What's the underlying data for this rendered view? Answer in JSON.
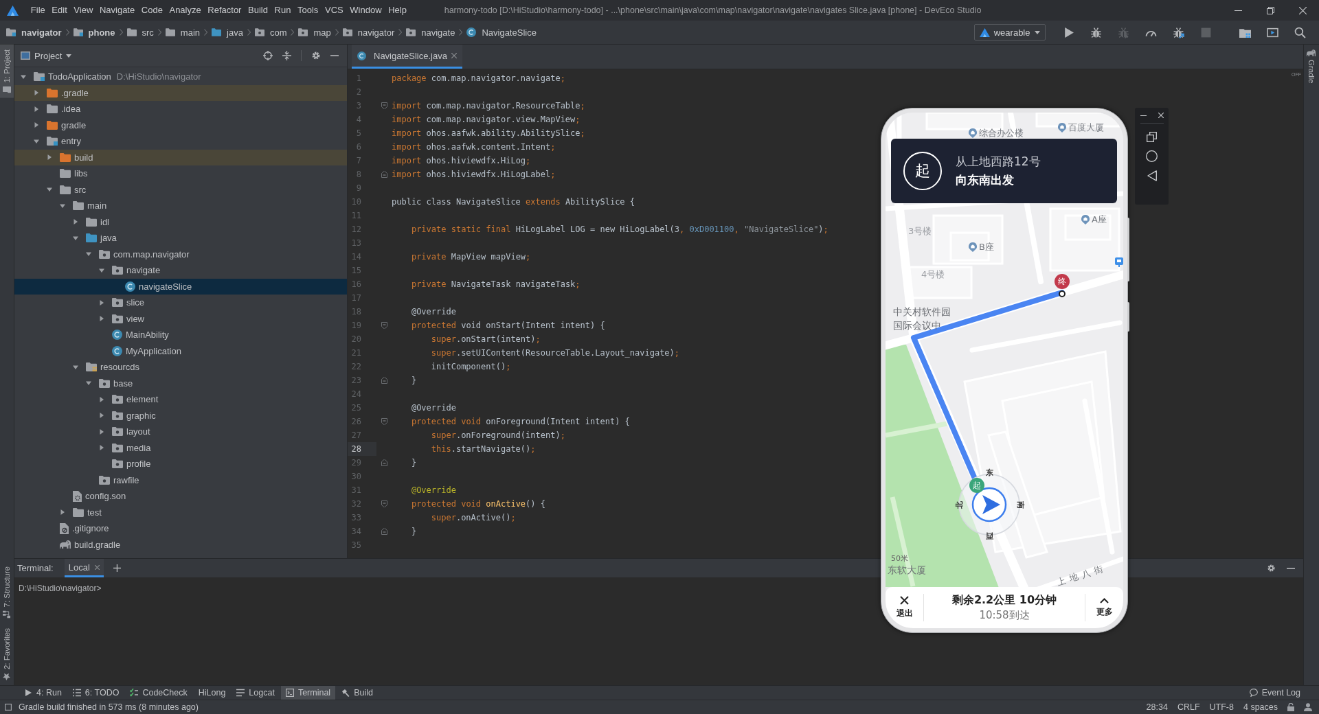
{
  "window": {
    "title": "harmony-todo [D:\\HiStudio\\harmony-todo] - ...\\phone\\src\\main\\java\\com\\map\\navigator\\navigate\\navigates Slice.java [phone] - DevEco Studio",
    "menu": [
      "File",
      "Edit",
      "View",
      "Navigate",
      "Code",
      "Analyze",
      "Refactor",
      "Build",
      "Run",
      "Tools",
      "VCS",
      "Window",
      "Help"
    ]
  },
  "navbar": {
    "breadcrumbs": [
      {
        "label": "navigator",
        "kind": "module"
      },
      {
        "label": "phone",
        "kind": "module"
      },
      {
        "label": "src",
        "kind": "folder"
      },
      {
        "label": "main",
        "kind": "folder"
      },
      {
        "label": "java",
        "kind": "source-root"
      },
      {
        "label": "com",
        "kind": "package"
      },
      {
        "label": "map",
        "kind": "package"
      },
      {
        "label": "navigator",
        "kind": "package"
      },
      {
        "label": "navigate",
        "kind": "package"
      },
      {
        "label": "NavigateSlice",
        "kind": "class"
      }
    ],
    "run_config": "wearable",
    "actions": [
      {
        "kind": "run",
        "disabled": false
      },
      {
        "kind": "debug",
        "disabled": false
      },
      {
        "kind": "attach",
        "disabled": true
      },
      {
        "kind": "profile",
        "disabled": false
      },
      {
        "kind": "debug-attach",
        "disabled": false
      },
      {
        "kind": "stop",
        "disabled": true
      },
      {
        "kind": "project-structure",
        "disabled": false
      },
      {
        "kind": "device-manager",
        "disabled": false
      },
      {
        "kind": "search",
        "disabled": false
      }
    ]
  },
  "side_tabs": {
    "left": [
      {
        "label": "1: Project",
        "kind": "project",
        "selected": true
      },
      {
        "label": "7: Structure",
        "kind": "structure",
        "selected": false
      },
      {
        "label": "2: Favorites",
        "kind": "favorites",
        "selected": false
      }
    ],
    "right": [
      {
        "label": "Gradle",
        "kind": "gradle",
        "selected": false
      }
    ]
  },
  "project": {
    "title": "Project",
    "tree": [
      {
        "label": "TodoApplication",
        "path": "D:\\HiStudio\\navigator",
        "kind": "module",
        "expanded": true,
        "selected": false,
        "ignored": false,
        "children": [
          {
            "label": ".gradle",
            "kind": "excluded-folder",
            "expanded": false,
            "selected": false,
            "ignored": true
          },
          {
            "label": ".idea",
            "kind": "folder",
            "expanded": false,
            "selected": false,
            "ignored": false
          },
          {
            "label": "gradle",
            "kind": "excluded-folder",
            "expanded": false,
            "selected": false,
            "ignored": false
          },
          {
            "label": "entry",
            "kind": "module",
            "expanded": true,
            "selected": false,
            "ignored": false,
            "children": [
              {
                "label": "build",
                "kind": "excluded-folder",
                "expanded": false,
                "selected": false,
                "ignored": true
              },
              {
                "label": "libs",
                "kind": "folder",
                "selected": false,
                "ignored": false
              },
              {
                "label": "src",
                "kind": "folder",
                "expanded": true,
                "selected": false,
                "ignored": false,
                "children": [
                  {
                    "label": "main",
                    "kind": "folder",
                    "expanded": true,
                    "selected": false,
                    "ignored": false,
                    "children": [
                      {
                        "label": "idl",
                        "kind": "folder",
                        "expanded": false,
                        "selected": false,
                        "ignored": false
                      },
                      {
                        "label": "java",
                        "kind": "source-root",
                        "expanded": true,
                        "selected": false,
                        "ignored": false,
                        "children": [
                          {
                            "label": "com.map.navigator",
                            "kind": "package",
                            "expanded": true,
                            "selected": false,
                            "ignored": false,
                            "children": [
                              {
                                "label": "navigate",
                                "kind": "package",
                                "expanded": true,
                                "selected": false,
                                "ignored": false,
                                "children": [
                                  {
                                    "label": "navigateSlice",
                                    "kind": "class",
                                    "selected": true,
                                    "ignored": false
                                  }
                                ]
                              },
                              {
                                "label": "slice",
                                "kind": "package",
                                "expanded": false,
                                "selected": false,
                                "ignored": false
                              },
                              {
                                "label": "view",
                                "kind": "package",
                                "expanded": false,
                                "selected": false,
                                "ignored": false
                              },
                              {
                                "label": "MainAbility",
                                "kind": "class",
                                "selected": false,
                                "ignored": false
                              },
                              {
                                "label": "MyApplication",
                                "kind": "class",
                                "selected": false,
                                "ignored": false
                              }
                            ]
                          }
                        ]
                      },
                      {
                        "label": "resourcds",
                        "kind": "resources-root",
                        "expanded": true,
                        "selected": false,
                        "ignored": false,
                        "children": [
                          {
                            "label": "base",
                            "kind": "package",
                            "expanded": true,
                            "selected": false,
                            "ignored": false,
                            "children": [
                              {
                                "label": "element",
                                "kind": "package",
                                "expanded": false,
                                "selected": false,
                                "ignored": false
                              },
                              {
                                "label": "graphic",
                                "kind": "package",
                                "expanded": false,
                                "selected": false,
                                "ignored": false
                              },
                              {
                                "label": "layout",
                                "kind": "package",
                                "expanded": false,
                                "selected": false,
                                "ignored": false
                              },
                              {
                                "label": "media",
                                "kind": "package",
                                "expanded": false,
                                "selected": false,
                                "ignored": false
                              },
                              {
                                "label": "profile",
                                "kind": "package",
                                "selected": false,
                                "ignored": false
                              }
                            ]
                          },
                          {
                            "label": "rawfile",
                            "kind": "package",
                            "selected": false,
                            "ignored": false
                          }
                        ]
                      }
                    ]
                  },
                  {
                    "label": "config.son",
                    "kind": "config-file",
                    "selected": false,
                    "ignored": false
                  },
                  {
                    "label": "test",
                    "kind": "folder",
                    "expanded": false,
                    "selected": false,
                    "ignored": false
                  }
                ]
              },
              {
                "label": ".gitignore",
                "kind": "ignore-file",
                "selected": false,
                "ignored": false
              },
              {
                "label": "build.gradle",
                "kind": "gradle-file",
                "selected": false,
                "ignored": false
              }
            ]
          }
        ]
      }
    ]
  },
  "editor": {
    "tabs": [
      {
        "label": "NavigateSlice.java",
        "selected": true
      }
    ],
    "badge": "OFF",
    "lines": [
      {
        "number": "1",
        "kind": "code",
        "current": false,
        "segments": [
          {
            "kind": "keyword",
            "text": "package"
          },
          {
            "kind": "plain",
            "text": " com.map.navigator.navigate"
          },
          {
            "kind": "keyword",
            "text": ";"
          }
        ]
      },
      {
        "number": "2",
        "kind": "code",
        "current": false
      },
      {
        "number": "3",
        "kind": "fold-start",
        "current": false,
        "segments": [
          {
            "kind": "keyword",
            "text": "import"
          },
          {
            "kind": "plain",
            "text": " com.map.navigator.ResourceTable"
          },
          {
            "kind": "keyword",
            "text": ";"
          }
        ]
      },
      {
        "number": "4",
        "kind": "code",
        "current": false,
        "segments": [
          {
            "kind": "keyword",
            "text": "import"
          },
          {
            "kind": "plain",
            "text": " com.map.navigator.view.MapView"
          },
          {
            "kind": "keyword",
            "text": ";"
          }
        ]
      },
      {
        "number": "5",
        "kind": "code",
        "current": false,
        "segments": [
          {
            "kind": "keyword",
            "text": "import"
          },
          {
            "kind": "plain",
            "text": " ohos.aafwk.ability.AbilitySlice"
          },
          {
            "kind": "keyword",
            "text": ";"
          }
        ]
      },
      {
        "number": "6",
        "kind": "code",
        "current": false,
        "segments": [
          {
            "kind": "keyword",
            "text": "import"
          },
          {
            "kind": "plain",
            "text": " ohos.aafwk.content.Intent"
          },
          {
            "kind": "keyword",
            "text": ";"
          }
        ]
      },
      {
        "number": "7",
        "kind": "code",
        "current": false,
        "segments": [
          {
            "kind": "keyword",
            "text": "import"
          },
          {
            "kind": "plain",
            "text": " ohos.hiviewdfx.HiLog"
          },
          {
            "kind": "keyword",
            "text": ";"
          }
        ]
      },
      {
        "number": "8",
        "kind": "fold-end",
        "current": false,
        "segments": [
          {
            "kind": "keyword",
            "text": "import"
          },
          {
            "kind": "plain",
            "text": " ohos.hiviewdfx.HiLogLabel"
          },
          {
            "kind": "keyword",
            "text": ";"
          }
        ]
      },
      {
        "number": "9",
        "kind": "code",
        "current": false
      },
      {
        "number": "10",
        "kind": "code",
        "current": false,
        "segments": [
          {
            "kind": "plain",
            "text": "public class NavigateSlice "
          },
          {
            "kind": "keyword",
            "text": "extends"
          },
          {
            "kind": "plain",
            "text": " AbilitySlice {"
          }
        ]
      },
      {
        "number": "11",
        "kind": "code",
        "current": false
      },
      {
        "number": "12",
        "kind": "code",
        "current": false,
        "segments": [
          {
            "kind": "keyword",
            "text": "    private static final"
          },
          {
            "kind": "plain",
            "text": " HiLogLabel LOG = new HiLogLabel(3"
          },
          {
            "kind": "keyword",
            "text": ", "
          },
          {
            "kind": "number",
            "text": "0xD001100"
          },
          {
            "kind": "keyword",
            "text": ", "
          },
          {
            "kind": "string",
            "text": "\"NavigateSlice\""
          },
          {
            "kind": "plain",
            "text": ")"
          },
          {
            "kind": "keyword",
            "text": ";"
          }
        ]
      },
      {
        "number": "13",
        "kind": "code",
        "current": false
      },
      {
        "number": "14",
        "kind": "code",
        "current": false,
        "segments": [
          {
            "kind": "keyword",
            "text": "    private"
          },
          {
            "kind": "plain",
            "text": " MapView mapView"
          },
          {
            "kind": "keyword",
            "text": ";"
          }
        ]
      },
      {
        "number": "15",
        "kind": "code",
        "current": false
      },
      {
        "number": "16",
        "kind": "code",
        "current": false,
        "segments": [
          {
            "kind": "keyword",
            "text": "    private"
          },
          {
            "kind": "plain",
            "text": " NavigateTask navigateTask"
          },
          {
            "kind": "keyword",
            "text": ";"
          }
        ]
      },
      {
        "number": "17",
        "kind": "code",
        "current": false
      },
      {
        "number": "18",
        "kind": "code",
        "current": false,
        "segments": [
          {
            "kind": "plain",
            "text": "    @Override"
          }
        ]
      },
      {
        "number": "19",
        "kind": "fold-start",
        "current": false,
        "segments": [
          {
            "kind": "keyword",
            "text": "    protected"
          },
          {
            "kind": "plain",
            "text": " void onStart(Intent intent) {"
          }
        ]
      },
      {
        "number": "20",
        "kind": "code",
        "current": false,
        "segments": [
          {
            "kind": "keyword",
            "text": "        super"
          },
          {
            "kind": "plain",
            "text": ".onStart(intent)"
          },
          {
            "kind": "keyword",
            "text": ";"
          }
        ]
      },
      {
        "number": "21",
        "kind": "code",
        "current": false,
        "segments": [
          {
            "kind": "keyword",
            "text": "        super"
          },
          {
            "kind": "plain",
            "text": ".setUIContent(ResourceTable.Layout_navigate)"
          },
          {
            "kind": "keyword",
            "text": ";"
          }
        ]
      },
      {
        "number": "22",
        "kind": "code",
        "current": false,
        "segments": [
          {
            "kind": "plain",
            "text": "        initComponent()"
          },
          {
            "kind": "keyword",
            "text": ";"
          }
        ]
      },
      {
        "number": "23",
        "kind": "fold-end",
        "current": false,
        "segments": [
          {
            "kind": "plain",
            "text": "    }"
          }
        ]
      },
      {
        "number": "24",
        "kind": "code",
        "current": false
      },
      {
        "number": "25",
        "kind": "code",
        "current": false,
        "segments": [
          {
            "kind": "plain",
            "text": "    @Override"
          }
        ]
      },
      {
        "number": "26",
        "kind": "fold-start",
        "current": false,
        "segments": [
          {
            "kind": "keyword",
            "text": "    protected void"
          },
          {
            "kind": "plain",
            "text": " onForeground(Intent intent) {"
          }
        ]
      },
      {
        "number": "27",
        "kind": "code",
        "current": false,
        "segments": [
          {
            "kind": "keyword",
            "text": "        super"
          },
          {
            "kind": "plain",
            "text": ".onForeground(intent)"
          },
          {
            "kind": "keyword",
            "text": ";"
          }
        ]
      },
      {
        "number": "28",
        "kind": "code",
        "current": true,
        "segments": [
          {
            "kind": "keyword",
            "text": "        this"
          },
          {
            "kind": "plain",
            "text": ".startNavigate()"
          },
          {
            "kind": "keyword",
            "text": ";"
          }
        ]
      },
      {
        "number": "29",
        "kind": "fold-end",
        "current": false,
        "segments": [
          {
            "kind": "plain",
            "text": "    }"
          }
        ]
      },
      {
        "number": "30",
        "kind": "code",
        "current": false
      },
      {
        "number": "31",
        "kind": "code",
        "current": false,
        "segments": [
          {
            "kind": "annotation",
            "text": "    @Override"
          }
        ]
      },
      {
        "number": "32",
        "kind": "fold-start",
        "current": false,
        "segments": [
          {
            "kind": "keyword",
            "text": "    protected void"
          },
          {
            "kind": "method",
            "text": " onActive"
          },
          {
            "kind": "plain",
            "text": "() {"
          }
        ]
      },
      {
        "number": "33",
        "kind": "code",
        "current": false,
        "segments": [
          {
            "kind": "keyword",
            "text": "        super"
          },
          {
            "kind": "plain",
            "text": ".onActive()"
          },
          {
            "kind": "keyword",
            "text": ";"
          }
        ]
      },
      {
        "number": "34",
        "kind": "fold-end",
        "current": false,
        "segments": [
          {
            "kind": "plain",
            "text": "    }"
          }
        ]
      },
      {
        "number": "35",
        "kind": "code",
        "current": false
      }
    ]
  },
  "emulator": {
    "guidance": {
      "badge": "起",
      "street": "从上地西路12号",
      "instruction": "向东南出发"
    },
    "map_labels": [
      {
        "text": "综合办公楼",
        "kind": "poi"
      },
      {
        "text": "百度大厦",
        "kind": "poi"
      },
      {
        "text": "A座",
        "kind": "poi"
      },
      {
        "text": "3号楼",
        "kind": "building"
      },
      {
        "text": "B座",
        "kind": "poi"
      },
      {
        "text": "4号楼",
        "kind": "building"
      },
      {
        "text": "中关村软件园",
        "kind": "area"
      },
      {
        "text": "国际会议中",
        "kind": "area"
      },
      {
        "text": "东软大厦",
        "kind": "area"
      },
      {
        "text": "上地八街",
        "kind": "road"
      }
    ],
    "scale": "50米",
    "route": {
      "start": "起",
      "end": "终"
    },
    "compass": {
      "top": "东",
      "right": "南",
      "bottom": "西",
      "left": "北"
    },
    "summary": {
      "remaining": "剩余2.2公里 10分钟",
      "arrival": "10:58到达"
    },
    "exit": "退出",
    "more": "更多"
  },
  "terminal": {
    "title": "Terminal:",
    "tabs": [
      {
        "label": "Local",
        "selected": true
      }
    ],
    "prompt": "D:\\HiStudio\\navigator>"
  },
  "tool_windows": [
    {
      "label": "4: Run",
      "kind": "run",
      "selected": false
    },
    {
      "label": "6: TODO",
      "kind": "todo",
      "selected": false
    },
    {
      "label": "CodeCheck",
      "kind": "codecheck",
      "selected": false
    },
    {
      "label": "HiLong",
      "kind": "plain",
      "selected": false
    },
    {
      "label": "Logcat",
      "kind": "logcat",
      "selected": false
    },
    {
      "label": "Terminal",
      "kind": "terminal",
      "selected": true
    },
    {
      "label": "Build",
      "kind": "build",
      "selected": false
    }
  ],
  "event_log": "Event Log",
  "status_bar": {
    "message": "Gradle build finished in 573 ms (8 minutes ago)",
    "position": "28:34",
    "line_separator": "CRLF",
    "encoding": "UTF-8",
    "indent": "4 spaces"
  }
}
